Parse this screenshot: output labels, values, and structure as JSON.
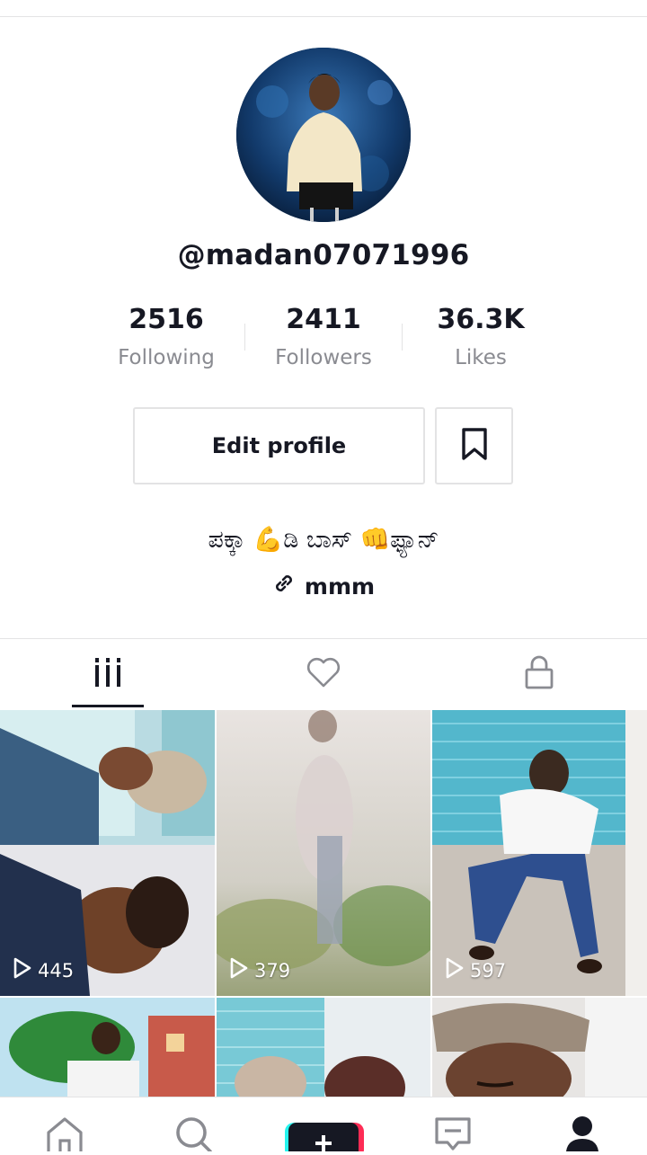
{
  "profile": {
    "username": "@madan07071996",
    "stats": [
      {
        "value": "2516",
        "label": "Following"
      },
      {
        "value": "2411",
        "label": "Followers"
      },
      {
        "value": "36.3K",
        "label": "Likes"
      }
    ],
    "edit_label": "Edit profile",
    "bio": "ಪಕ್ಕಾ 💪ಡಿ ಬಾಸ್ 👊ಫ್ಯಾನ್",
    "link": "mmm"
  },
  "tabs": [
    {
      "name": "videos",
      "icon": "grid-icon",
      "active": true
    },
    {
      "name": "liked",
      "icon": "heart-icon",
      "active": false
    },
    {
      "name": "private",
      "icon": "lock-icon",
      "active": false
    }
  ],
  "videos": [
    {
      "views": "445"
    },
    {
      "views": "379"
    },
    {
      "views": "597"
    },
    {
      "views": ""
    },
    {
      "views": ""
    },
    {
      "views": ""
    }
  ],
  "bottom_nav": [
    "home-icon",
    "search-icon",
    "create-icon",
    "inbox-icon",
    "profile-icon"
  ],
  "colors": {
    "text": "#161823",
    "muted": "#8a8b91",
    "border": "#e3e3e4",
    "create_red": "#fe2c55",
    "create_cyan": "#25f4ee"
  }
}
